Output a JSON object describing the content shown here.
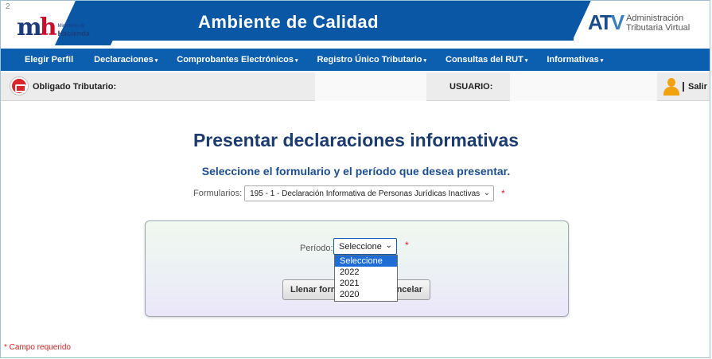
{
  "banner": {
    "page_number": "2",
    "brand_letters_1": "m",
    "brand_letters_2": "h",
    "brand_small": "Ministerio de",
    "brand_big": "Hacienda",
    "title": "Ambiente de Calidad",
    "atv_letters_1": "AT",
    "atv_letters_2": "V",
    "atv_line1": "Administración",
    "atv_line2": "Tributaria Virtual",
    "color": "#0a57a6"
  },
  "nav": {
    "items": [
      {
        "label": "Elegir Perfil",
        "caret": ""
      },
      {
        "label": "Declaraciones",
        "caret": "▾"
      },
      {
        "label": "Comprobantes Electrónicos",
        "caret": "▾"
      },
      {
        "label": "Registro Único Tributario",
        "caret": "▾"
      },
      {
        "label": "Consultas del RUT",
        "caret": "▾"
      },
      {
        "label": "Informativas",
        "caret": "▾"
      }
    ]
  },
  "infobar": {
    "obligado_label": "Obligado Tributario:",
    "usuario_label": "USUARIO:",
    "salir": "Salir"
  },
  "main": {
    "title": "Presentar declaraciones informativas",
    "subtitle": "Seleccione el formulario y el período que desea presentar.",
    "formularios_label": "Formularios:",
    "formularios_value": "195 - 1 - Declaración Informativa de Personas Jurídicas Inactivas",
    "required_marker": "*"
  },
  "panel": {
    "periodo_label": "Período:",
    "periodo_value": "Seleccione",
    "llenar_button": "Llenar formulario",
    "cancelar_button": "Cancelar",
    "options": [
      "Seleccione",
      "2022",
      "2021",
      "2020"
    ],
    "selected_option": "Seleccione"
  },
  "footer": {
    "required_note": "* Campo requerido"
  }
}
